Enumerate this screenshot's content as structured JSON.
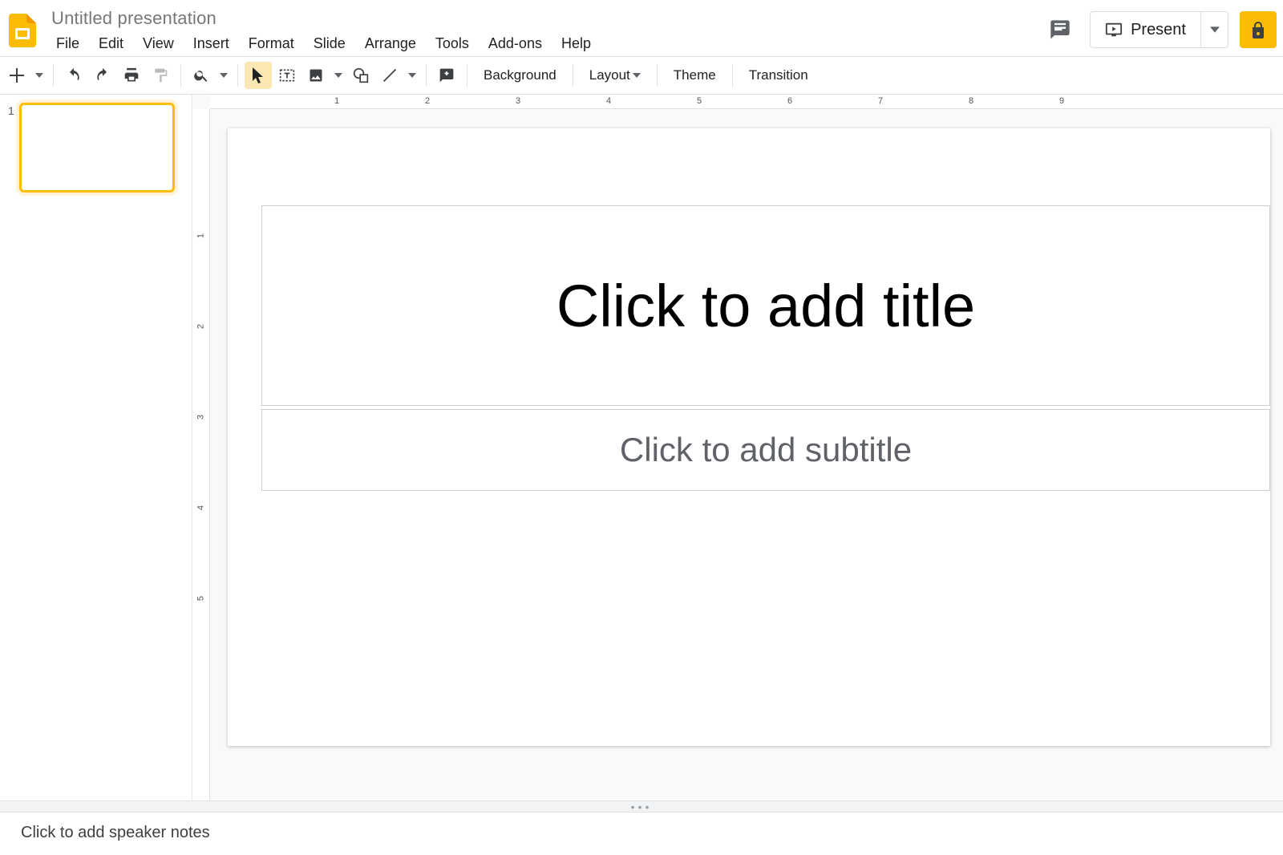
{
  "header": {
    "doc_title": "Untitled presentation",
    "present_label": "Present"
  },
  "menubar": {
    "items": [
      "File",
      "Edit",
      "View",
      "Insert",
      "Format",
      "Slide",
      "Arrange",
      "Tools",
      "Add-ons",
      "Help"
    ]
  },
  "toolbar": {
    "background_label": "Background",
    "layout_label": "Layout",
    "theme_label": "Theme",
    "transition_label": "Transition"
  },
  "filmstrip": {
    "slides": [
      {
        "number": "1"
      }
    ]
  },
  "hruler": {
    "labels": [
      "1",
      "2",
      "3",
      "4",
      "5",
      "6",
      "7",
      "8",
      "9"
    ]
  },
  "vruler": {
    "labels": [
      "1",
      "2",
      "3",
      "4",
      "5"
    ]
  },
  "slide": {
    "title_placeholder": "Click to add title",
    "subtitle_placeholder": "Click to add subtitle"
  },
  "speaker_notes": {
    "placeholder": "Click to add speaker notes"
  }
}
